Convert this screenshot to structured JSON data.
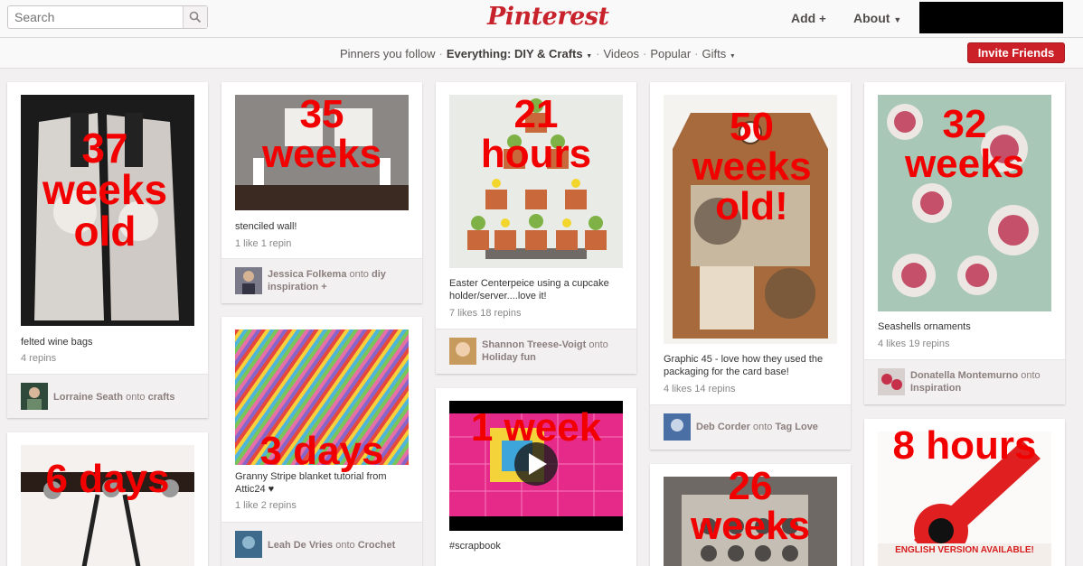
{
  "header": {
    "search_placeholder": "Search",
    "logo": "Pinterest",
    "add_label": "Add",
    "about_label": "About"
  },
  "subnav": {
    "items": [
      "Pinners you follow",
      "Everything: DIY & Crafts",
      "Videos",
      "Popular",
      "Gifts"
    ],
    "invite_label": "Invite Friends"
  },
  "icons": [
    "search-icon",
    "plus-icon",
    "caret-down-icon",
    "play-icon"
  ],
  "colors": {
    "brand_red": "#c8232c",
    "overlay_red": "#f20000",
    "invite_button": "#cb2027"
  },
  "pins": [
    {
      "overlay": "37 weeks old",
      "description": "felted wine bags",
      "stats": "4 repins",
      "pinner": "Lorraine Seath",
      "board": "crafts"
    },
    {
      "overlay": "35 weeks",
      "description": "stenciled wall!",
      "stats": "1 like  1 repin",
      "pinner": "Jessica Folkema",
      "board": "diy inspiration +"
    },
    {
      "overlay": "21 hours",
      "description": "Easter Centerpeice using a cupcake holder/server....love it!",
      "stats": "7 likes  18 repins",
      "pinner": "Shannon Treese-Voigt",
      "board": "Holiday fun"
    },
    {
      "overlay": "50 weeks old!",
      "description": "Graphic 45 - love how they used the packaging for the card base!",
      "stats": "4 likes  14 repins",
      "pinner": "Deb Corder",
      "board": "Tag Love"
    },
    {
      "overlay": "32 weeks",
      "description": "Seashells ornaments",
      "stats": "4 likes  19 repins",
      "pinner": "Donatella Montemurno",
      "board": "Inspiration"
    },
    {
      "overlay": "6 days"
    },
    {
      "overlay": "3 days",
      "description": "Granny Stripe blanket tutorial from Attic24 ♥",
      "stats": "1 like  2 repins",
      "pinner": "Leah De Vries",
      "board": "Crochet"
    },
    {
      "overlay": "1 week",
      "description": "#scrapbook"
    },
    {
      "overlay": "26 weeks"
    },
    {
      "overlay": "8 hours",
      "image_text": "ENGLISH VERSION AVAILABLE!"
    }
  ],
  "onto": "onto"
}
